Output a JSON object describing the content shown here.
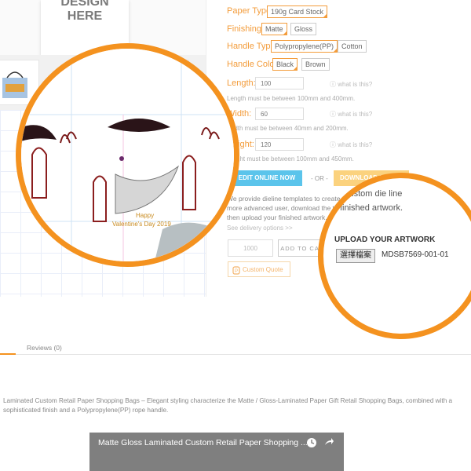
{
  "design_card": {
    "line1": "DESIGN",
    "line2": "HERE"
  },
  "options": {
    "paper_type": {
      "label": "Paper Type",
      "options": [
        "190g Card Stock"
      ],
      "selected": "190g Card Stock"
    },
    "finishing": {
      "label": "Finishing",
      "options": [
        "Matte",
        "Gloss"
      ],
      "selected": "Matte"
    },
    "handle_type": {
      "label": "Handle Type",
      "options": [
        "Polypropylene(PP)",
        "Cotton"
      ],
      "selected": "Polypropylene(PP)"
    },
    "handle_color": {
      "label": "Handle Color",
      "options": [
        "Black",
        "Brown"
      ],
      "selected": "Black"
    }
  },
  "dimensions": {
    "help_text": "ⓘ what is this?",
    "length": {
      "label": "Length:",
      "value": "100",
      "hint": "Length must be between 100mm and 400mm."
    },
    "width": {
      "label": "Width:",
      "value": "60",
      "hint": "Width must be between 40mm and 200mm."
    },
    "height": {
      "label": "Height:",
      "value": "120",
      "hint": "Height must be between 100mm and 450mm."
    }
  },
  "actions": {
    "edit_online": "EDIT ONLINE NOW",
    "or": "- OR -",
    "download": "DOWNLOAD DIELINE TEMPLATE"
  },
  "info": {
    "para1": "We provide dieline templates to create your custom die line design. If you are a more advanced user, download the template, design it with Adobe® Illustrator® then upload your finished artwork.",
    "delivery": "See delivery options >>"
  },
  "cart": {
    "quantity": "1000",
    "add_to_cart": "ADD TO CART",
    "custom_quote": "Custom Quote"
  },
  "zoom_right": {
    "line1": "our custom die line",
    "line2": "our finished artwork.",
    "upload_heading": "UPLOAD YOUR ARTWORK",
    "choose_file": "選擇檔案",
    "filename": "MDSB7569-001-01"
  },
  "zoom_left": {
    "happy_line1": "Happy",
    "happy_line2": "Valentine's Day 2019"
  },
  "tabs": {
    "reviews": "Reviews (0)"
  },
  "description": "Laminated Custom Retail Paper Shopping Bags – Elegant styling characterize the Matte / Gloss-Laminated Paper Gift Retail Shopping Bags, combined with a sophisticated finish and a Polypropylene(PP) rope handle.",
  "video": {
    "title": "Matte Gloss Laminated Custom Retail Paper Shopping ..."
  },
  "colors": {
    "accent": "#f4921f",
    "option_label": "#f39c3b",
    "edit_btn": "#5bc4eb",
    "download_btn": "#fbd27e"
  }
}
